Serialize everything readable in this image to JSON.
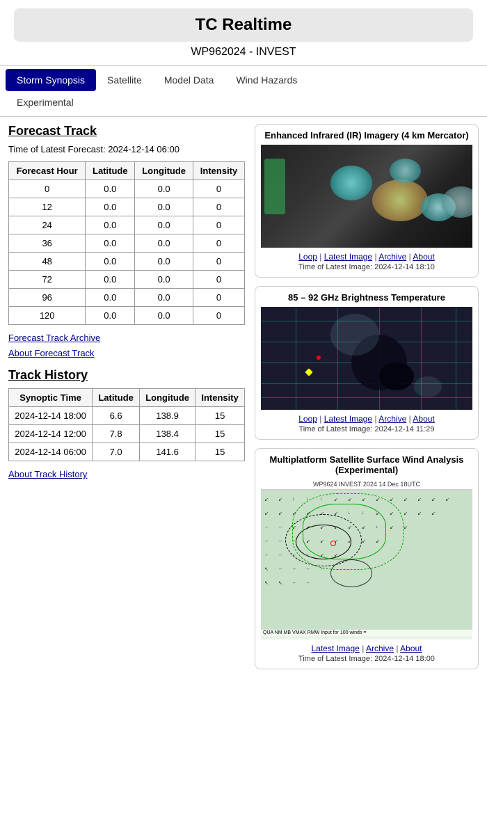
{
  "app": {
    "title": "TC Realtime",
    "storm_id": "WP962024 - INVEST"
  },
  "nav": {
    "items": [
      {
        "label": "Storm Synopsis",
        "active": true
      },
      {
        "label": "Satellite",
        "active": false
      },
      {
        "label": "Model Data",
        "active": false
      },
      {
        "label": "Wind Hazards",
        "active": false
      },
      {
        "label": "Experimental",
        "active": false
      }
    ]
  },
  "forecast_track": {
    "section_title": "Forecast Track",
    "time_label": "Time of Latest Forecast: 2024-12-14 06:00",
    "table_headers": [
      "Forecast Hour",
      "Latitude",
      "Longitude",
      "Intensity"
    ],
    "rows": [
      {
        "hour": "0",
        "lat": "0.0",
        "lon": "0.0",
        "intensity": "0"
      },
      {
        "hour": "12",
        "lat": "0.0",
        "lon": "0.0",
        "intensity": "0"
      },
      {
        "hour": "24",
        "lat": "0.0",
        "lon": "0.0",
        "intensity": "0"
      },
      {
        "hour": "36",
        "lat": "0.0",
        "lon": "0.0",
        "intensity": "0"
      },
      {
        "hour": "48",
        "lat": "0.0",
        "lon": "0.0",
        "intensity": "0"
      },
      {
        "hour": "72",
        "lat": "0.0",
        "lon": "0.0",
        "intensity": "0"
      },
      {
        "hour": "96",
        "lat": "0.0",
        "lon": "0.0",
        "intensity": "0"
      },
      {
        "hour": "120",
        "lat": "0.0",
        "lon": "0.0",
        "intensity": "0"
      }
    ],
    "archive_link": "Forecast Track Archive",
    "about_link": "About Forecast Track"
  },
  "track_history": {
    "section_title": "Track History",
    "table_headers": [
      "Synoptic Time",
      "Latitude",
      "Longitude",
      "Intensity"
    ],
    "rows": [
      {
        "time": "2024-12-14 18:00",
        "lat": "6.6",
        "lon": "138.9",
        "intensity": "15"
      },
      {
        "time": "2024-12-14 12:00",
        "lat": "7.8",
        "lon": "138.4",
        "intensity": "15"
      },
      {
        "time": "2024-12-14 06:00",
        "lat": "7.0",
        "lon": "141.6",
        "intensity": "15"
      }
    ],
    "about_link": "About Track History"
  },
  "imagery": [
    {
      "id": "ir",
      "title": "Enhanced Infrared (IR) Imagery (4 km Mercator)",
      "links": [
        "Loop",
        "Latest Image",
        "Archive",
        "About"
      ],
      "time_label": "Time of Latest Image: 2024-12-14 18:10"
    },
    {
      "id": "ghz",
      "title": "85 – 92 GHz Brightness Temperature",
      "links": [
        "Loop",
        "Latest Image",
        "Archive",
        "About"
      ],
      "time_label": "Time of Latest Image: 2024-12-14 11:29"
    },
    {
      "id": "wind",
      "title": "Multiplatform Satellite Surface Wind Analysis (Experimental)",
      "subtitle": "WP9624   INVEST   2024 14 Dec  18UTC",
      "links": [
        "Latest Image",
        "Archive",
        "About"
      ],
      "time_label": "Time of Latest Image: 2024-12-14 18:00"
    }
  ],
  "colors": {
    "nav_active_bg": "#00008B",
    "link_color": "#00008B"
  }
}
